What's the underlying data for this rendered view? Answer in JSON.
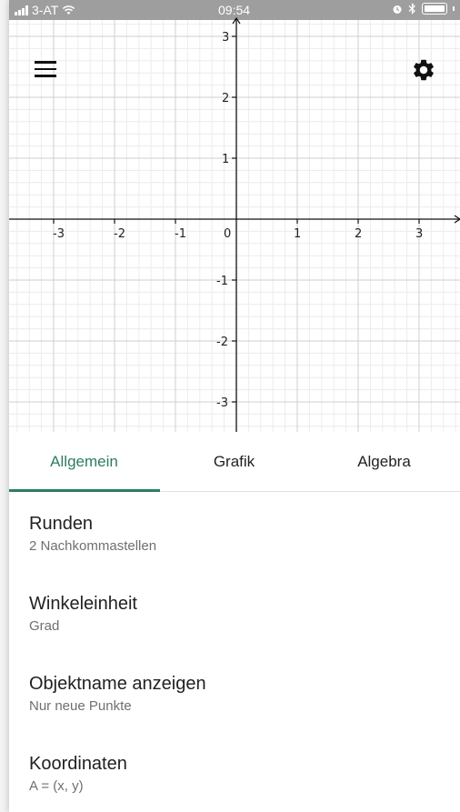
{
  "status_bar": {
    "carrier": "3-AT",
    "time": "09:54"
  },
  "toolbar": {
    "menu_icon": "hamburger-menu-icon",
    "settings_icon": "gear-icon"
  },
  "graph": {
    "x_ticks": [
      "-3",
      "-2",
      "-1",
      "0",
      "1",
      "2",
      "3"
    ],
    "y_ticks": [
      "3",
      "2",
      "1",
      "-1",
      "-2",
      "-3"
    ]
  },
  "tabs": [
    {
      "label": "Allgemein",
      "active": true
    },
    {
      "label": "Grafik",
      "active": false
    },
    {
      "label": "Algebra",
      "active": false
    }
  ],
  "settings": [
    {
      "title": "Runden",
      "value": "2 Nachkommastellen"
    },
    {
      "title": "Winkeleinheit",
      "value": "Grad"
    },
    {
      "title": "Objektname anzeigen",
      "value": "Nur neue Punkte"
    },
    {
      "title": "Koordinaten",
      "value": "A = (x, y)"
    }
  ],
  "colors": {
    "accent": "#2e7d5f",
    "status_bar_bg": "#9e9e9e",
    "grid_major": "#cfcfcf",
    "grid_minor": "#ececec"
  }
}
